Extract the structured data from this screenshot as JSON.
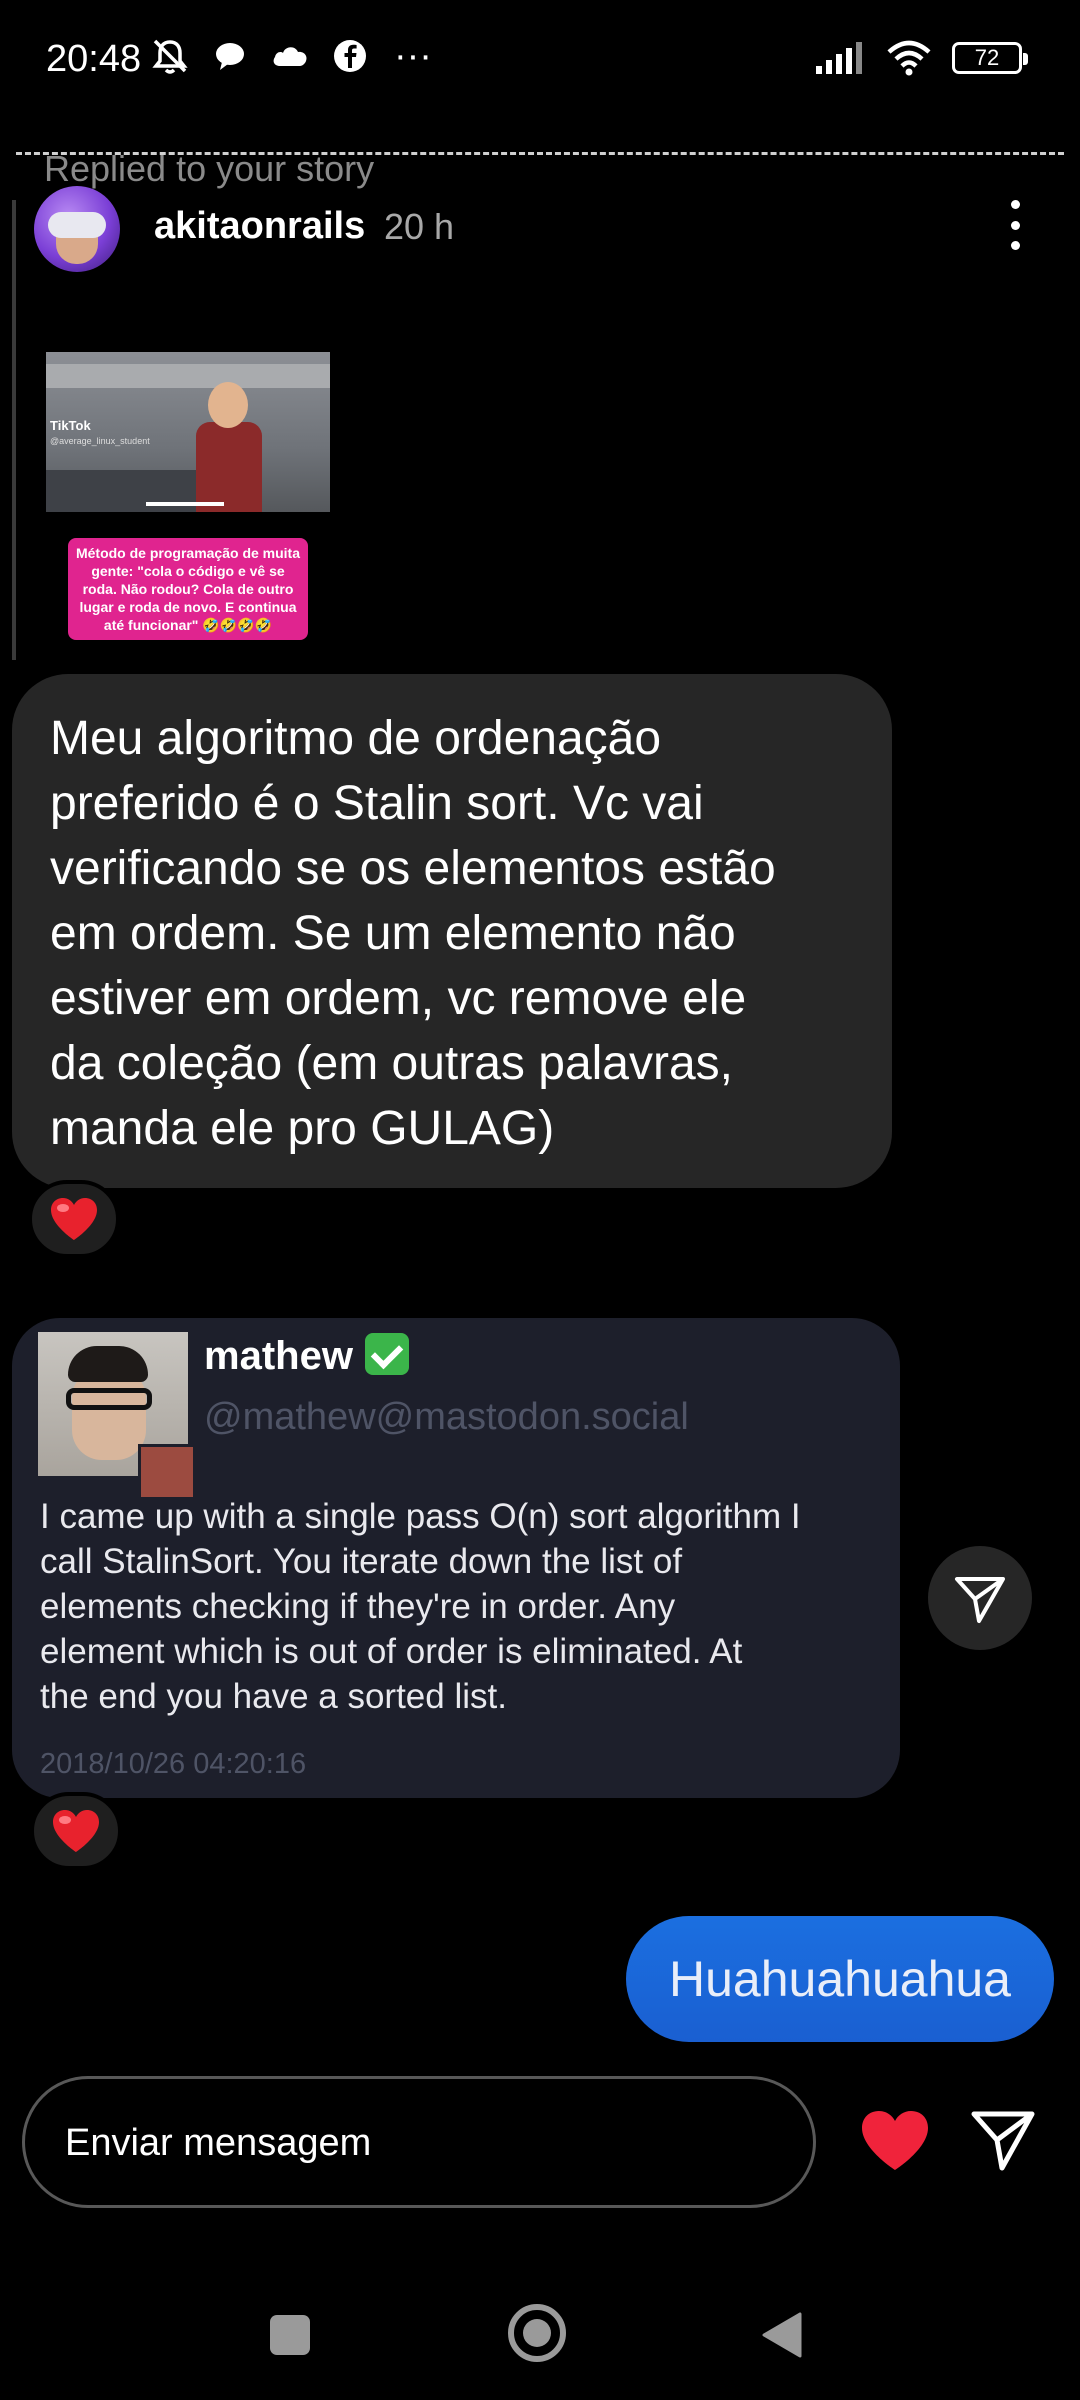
{
  "status_bar": {
    "time": "20:48",
    "more": "···",
    "battery": "72"
  },
  "story": {
    "replied_label": "Replied to your story",
    "username": "akitaonrails",
    "time_ago": "20 h",
    "tiktok_label": "TikTok",
    "tiktok_handle": "@average_linux_student",
    "caption": "Método de programação de muita gente: \"cola o código e vê se roda. Não rodou? Cola de outro lugar e roda de novo. E continua até funcionar\" 🤣🤣🤣🤣"
  },
  "messages": {
    "incoming_text": "Meu algoritmo de ordenação\npreferido é o Stalin sort. Vc vai\nverificando se os elementos estão\nem ordem. Se um elemento não\nestiver em ordem, vc remove ele\nda coleção (em outras palavras,\nmanda ele pro GULAG)",
    "outgoing_text": "Huahuahuahua"
  },
  "tweet": {
    "name": "mathew",
    "handle": "@mathew@mastodon.social",
    "text": "I came up with a single pass O(n) sort algorithm I\ncall StalinSort. You iterate down the list of\nelements checking if they're in order. Any\nelement which is out of order is eliminated. At\nthe end you have a sorted list.",
    "date": "2018/10/26 04:20:16"
  },
  "composer": {
    "placeholder": "Enviar mensagem"
  },
  "colors": {
    "reaction_heart": "#e8222d",
    "like_heart": "#f0233b",
    "outgoing_bubble": "#1a62d6",
    "incoming_bubble": "#262626",
    "verified_badge": "#3bb54a"
  },
  "icons": {
    "status_left": [
      "do-not-disturb-bell-icon",
      "chat-bubble-icon",
      "cloud-icon",
      "facebook-icon"
    ],
    "status_right": [
      "signal-icon",
      "wifi-icon",
      "battery-icon"
    ],
    "nav": [
      "recents-square-icon",
      "home-circle-icon",
      "back-triangle-icon"
    ]
  }
}
